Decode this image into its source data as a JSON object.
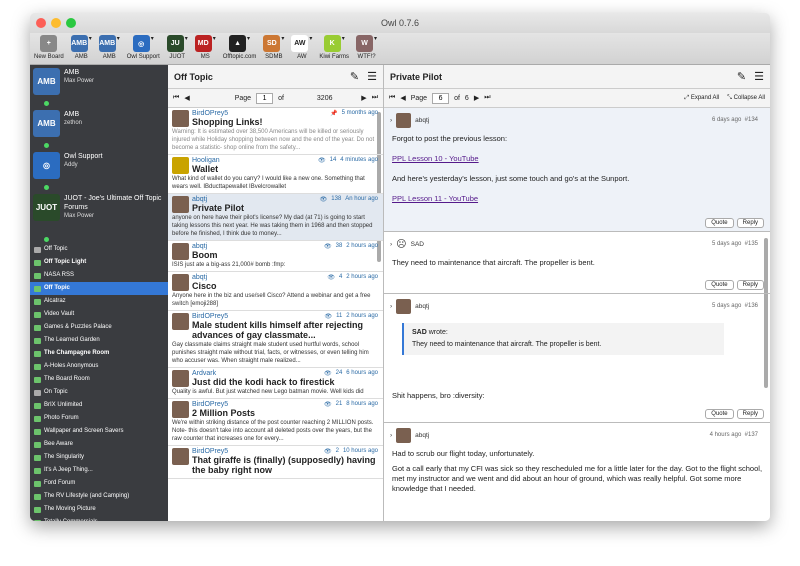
{
  "window": {
    "title": "Owl 0.7.6"
  },
  "toolbar": [
    {
      "label": "New Board",
      "icon": "plus-icon",
      "color": "#888",
      "glyph": "+"
    },
    {
      "label": "AMB",
      "icon": "amb-icon",
      "color": "#3c6fb0",
      "glyph": "AMB"
    },
    {
      "label": "AMB",
      "icon": "amb-icon",
      "color": "#3c6fb0",
      "glyph": "AMB"
    },
    {
      "label": "Owl Support",
      "icon": "owl-icon",
      "color": "#2b6cc0",
      "glyph": "◎"
    },
    {
      "label": "JUOT",
      "icon": "juot-icon",
      "color": "#2a4a2a",
      "glyph": "JU"
    },
    {
      "label": "MS",
      "icon": "ms-icon",
      "color": "#b22",
      "glyph": "MD"
    },
    {
      "label": "Offtopic.com",
      "icon": "offtopic-icon",
      "color": "#222",
      "glyph": "▲"
    },
    {
      "label": "SDMB",
      "icon": "sdmb-icon",
      "color": "#c73",
      "glyph": "SD"
    },
    {
      "label": "AW",
      "icon": "aw-icon",
      "color": "#fff",
      "glyph": "AW"
    },
    {
      "label": "Kiwi Farms",
      "icon": "kiwi-icon",
      "color": "#9c3",
      "glyph": "K"
    },
    {
      "label": "WTF!?",
      "icon": "wtf-icon",
      "color": "#866",
      "glyph": "W"
    }
  ],
  "sidebar": {
    "forums": [
      {
        "name": "AMB",
        "user": "Max Power",
        "logo": "AMB",
        "color": "#3c6fb0"
      },
      {
        "name": "AMB",
        "user": "zethon",
        "logo": "AMB",
        "color": "#3c6fb0"
      },
      {
        "name": "Owl Support",
        "user": "Addy",
        "logo": "◎",
        "color": "#2b6cc0"
      },
      {
        "name": "JUOT - Joe's Ultimate Off Topic Forums",
        "user": "Max Power",
        "logo": "JUOT",
        "color": "#2a4a2a"
      }
    ],
    "items": [
      "Off Topic",
      "Off Topic Light",
      "NASA RSS",
      "Off Topic",
      "Alcatraz",
      "Video Vault",
      "Games & Puzzles Palace",
      "The Learned Garden",
      "The Champagne Room",
      "A-Holes Anonymous",
      "The Board Room",
      "On Topic",
      "BrIX Unlimited",
      "Photo Forum",
      "Wallpaper and Screen Savers",
      "Bee Aware",
      "The Singularity",
      "It's A Jeep Thing...",
      "Ford Forum",
      "The RV Lifestyle (and Camping)",
      "The Moving Picture",
      "Totally Commercials",
      "This Old House"
    ]
  },
  "listpane": {
    "title": "Off Topic",
    "page_label": "Page",
    "page": "1",
    "of": "of",
    "total": "3206"
  },
  "topics": [
    {
      "author": "BirdOPrey5",
      "title": "Shopping Links!",
      "meta": "5 months ago",
      "views": "",
      "preview": "Warning: It is estimated over 38,500 Americans will be killed or seriously injured while Holiday shopping between now and the end of the year. Do not become a statistic- shop online from the safety..."
    },
    {
      "author": "Hooligan",
      "title": "Wallet",
      "meta": "4 minutes ago",
      "views": "14",
      "preview": "What kind of wallet do you carry? I would like a new one. Something that wears well. IBducttapewallet IBvelcrowallet"
    },
    {
      "author": "abqtj",
      "title": "Private Pilot",
      "meta": "An hour ago",
      "views": "138",
      "preview": "anyone on here have their pilot's license? My dad (at 71) is going to start taking lessons this next year. He was taking them in 1968 and then stopped before he finished, I think due to money..."
    },
    {
      "author": "abqtj",
      "title": "Boom",
      "meta": "2 hours ago",
      "views": "38",
      "preview": "ISIS just ate a big-ass 21,000# bomb :fmp:"
    },
    {
      "author": "abqtj",
      "title": "Cisco",
      "meta": "2 hours ago",
      "views": "4",
      "preview": "Anyone here in the biz and use/sell Cisco? Attend a webinar and get a free switch [emoji288]"
    },
    {
      "author": "BirdOPrey5",
      "title": "Male student kills himself after rejecting advances of gay classmate...",
      "meta": "2 hours ago",
      "views": "11",
      "preview": "Gay classmate claims straight male student used hurtful words, school punishes straight male without trial, facts, or witnesses, or even telling him who accuser was. When straight male realized..."
    },
    {
      "author": "Ardvark",
      "title": "Just did the kodi hack to firestick",
      "meta": "6 hours ago",
      "views": "24",
      "preview": "Quality is awful. But just watched new Lego batman movie. Well kids did"
    },
    {
      "author": "BirdOPrey5",
      "title": "2 Million Posts",
      "meta": "8 hours ago",
      "views": "21",
      "preview": "We're within striking distance of the post counter reaching 2 MILLION posts. Note- this doesn't take into account all deleted posts over the years, but the raw counter that increases one for every..."
    },
    {
      "author": "BirdOPrey5",
      "title": "That giraffe is (finally) (supposedly) having the baby right now",
      "meta": "10 hours ago",
      "views": "2",
      "preview": ""
    }
  ],
  "postpane": {
    "title": "Private Pilot",
    "page_label": "Page",
    "page": "6",
    "of": "of",
    "total": "6",
    "expand": "Expand All",
    "collapse": "Collapse All"
  },
  "posts": [
    {
      "author": "abqtj",
      "time": "6 days ago",
      "num": "#134",
      "lines": [
        "Forgot to post the previous lesson:"
      ],
      "link1": "PPL Lesson 10 - YouTube",
      "line2": "And here's yesterday's lesson, just some touch and go's at the Sunport.",
      "link2": "PPL Lesson 11 - YouTube"
    },
    {
      "author": "SAD",
      "time": "5 days ago",
      "num": "#135",
      "text": "They need to maintenance that aircraft. The propeller is bent."
    },
    {
      "author": "abqtj",
      "time": "5 days ago",
      "num": "#136",
      "quote_author": "SAD",
      "quote_wrote": "wrote:",
      "quote_text": "They need to maintenance that aircraft. The propeller is bent.",
      "text": "Shit happens, bro :diversity:"
    },
    {
      "author": "abqtj",
      "time": "4 hours ago",
      "num": "#137",
      "text1": "Had to scrub our flight today, unfortunately.",
      "text2": "Got a call early that my CFI was sick so they rescheduled me for a little later for the day. Got to the flight school, met my instructor and we went and did about an hour of ground, which was really helpful. Got some more knowledge that I needed."
    }
  ],
  "buttons": {
    "quote": "Quote",
    "reply": "Reply"
  }
}
